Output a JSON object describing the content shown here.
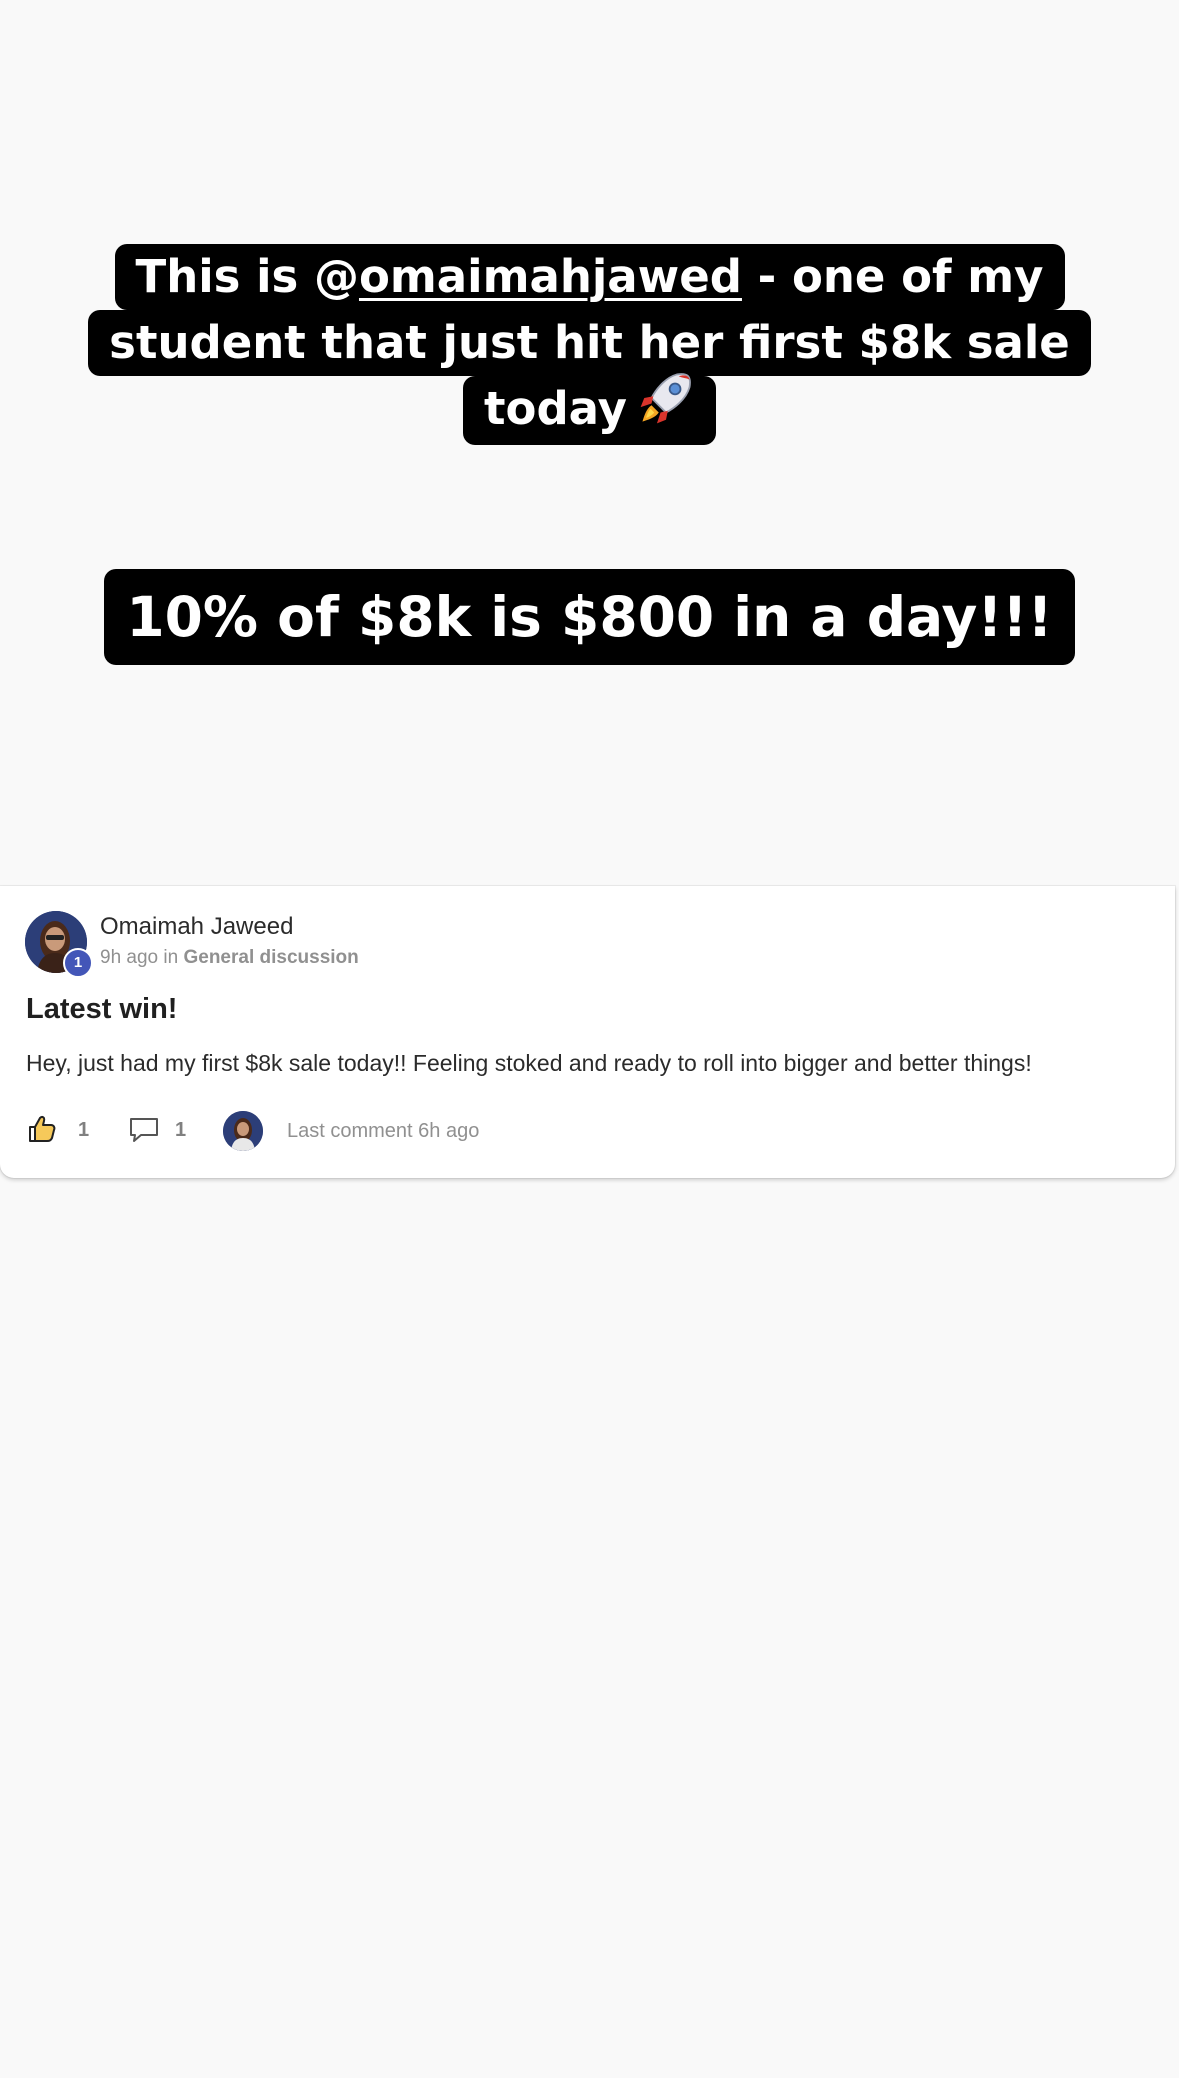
{
  "story": {
    "caption_1": {
      "line_a_prefix": "This is @",
      "line_a_handle": "omaimahjawed",
      "line_a_suffix": " - one of my",
      "line_b": "student that just hit her first $8k sale",
      "line_c": "today",
      "emoji": "rocket-icon"
    },
    "caption_2": "10% of $8k is $800 in a day!!!"
  },
  "post": {
    "author": "Omaimah Jaweed",
    "level": "1",
    "time": "9h ago",
    "in_word": " in ",
    "category": "General discussion",
    "title": "Latest win!",
    "body": "Hey, just had my first $8k sale today!! Feeling stoked and ready to roll into bigger and better things!",
    "likes": "1",
    "comments": "1",
    "last_comment": "Last comment 6h ago"
  },
  "colors": {
    "background": "#f9f9f9",
    "caption_bg": "#000000",
    "caption_text": "#ffffff",
    "badge": "#4356b8",
    "muted_text": "#909090"
  }
}
